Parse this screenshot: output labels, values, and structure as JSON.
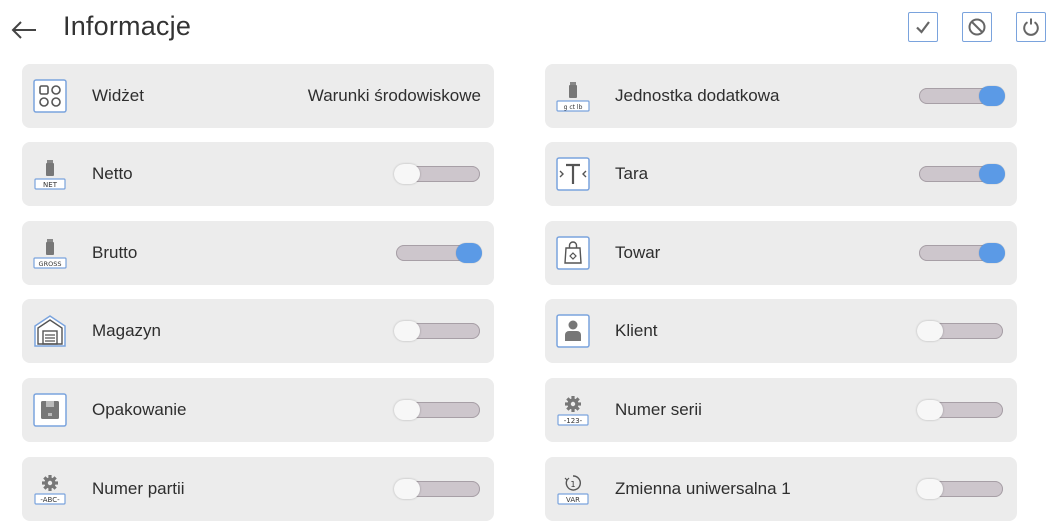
{
  "header": {
    "title": "Informacje"
  },
  "left_items": [
    {
      "label": "Widżet",
      "value": "Warunki środowiskowe",
      "icon": "widget-grid-icon"
    },
    {
      "label": "Netto",
      "on": false,
      "icon": "weight-net-icon",
      "icon_text": "NET"
    },
    {
      "label": "Brutto",
      "on": true,
      "icon": "weight-gross-icon",
      "icon_text": "GROSS"
    },
    {
      "label": "Magazyn",
      "on": false,
      "icon": "warehouse-icon"
    },
    {
      "label": "Opakowanie",
      "on": false,
      "icon": "package-icon"
    },
    {
      "label": "Numer partii",
      "on": false,
      "icon": "gear-abc-icon",
      "icon_text": "-ABC-"
    }
  ],
  "right_items": [
    {
      "label": "Jednostka dodatkowa",
      "on": true,
      "icon": "weight-unit-icon",
      "icon_text": "g ct lb"
    },
    {
      "label": "Tara",
      "on": true,
      "icon": "tare-icon"
    },
    {
      "label": "Towar",
      "on": true,
      "icon": "product-bag-icon"
    },
    {
      "label": "Klient",
      "on": false,
      "icon": "client-person-icon"
    },
    {
      "label": "Numer serii",
      "on": false,
      "icon": "gear-123-icon",
      "icon_text": "-123-"
    },
    {
      "label": "Zmienna uniwersalna 1",
      "on": false,
      "icon": "variable-one-icon",
      "icon_text": "VAR",
      "icon_num": "1"
    }
  ],
  "colors": {
    "accent": "#5b9ae6",
    "card": "#ececec",
    "icon_border": "#7aa3dd"
  }
}
